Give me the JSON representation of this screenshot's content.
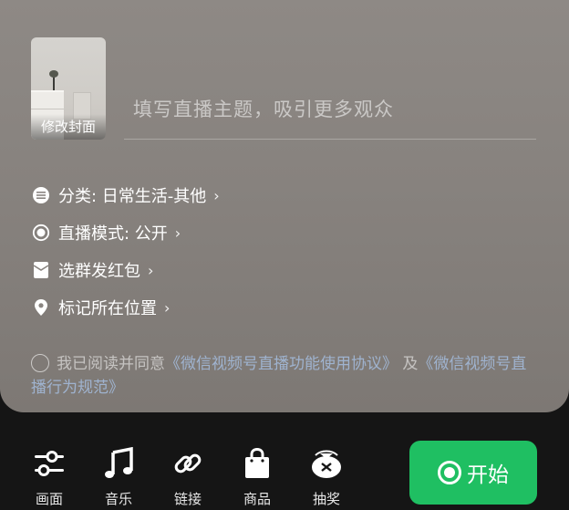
{
  "cover": {
    "label": "修改封面"
  },
  "title": {
    "placeholder": "填写直播主题，吸引更多观众"
  },
  "options": [
    {
      "icon": "list-icon",
      "label": "分类: 日常生活-其他",
      "chevron": "›"
    },
    {
      "icon": "radio-mode-icon",
      "label": "直播模式: 公开",
      "chevron": "›"
    },
    {
      "icon": "red-packet-icon",
      "label": "选群发红包",
      "chevron": "›"
    },
    {
      "icon": "location-pin-icon",
      "label": "标记所在位置",
      "chevron": "›"
    }
  ],
  "agreement": {
    "prefix": "我已阅读并同意",
    "link1": "《微信视频号直播功能使用协议》",
    "middle": " 及",
    "link2": "《微信视频号直播行为规范》"
  },
  "toolbar": [
    {
      "icon": "sliders-icon",
      "label": "画面"
    },
    {
      "icon": "music-note-icon",
      "label": "音乐"
    },
    {
      "icon": "link-icon",
      "label": "链接"
    },
    {
      "icon": "shopping-bag-icon",
      "label": "商品"
    },
    {
      "icon": "lottery-bag-icon",
      "label": "抽奖"
    }
  ],
  "start_button": {
    "label": "开始",
    "color": "#1fbf62"
  }
}
